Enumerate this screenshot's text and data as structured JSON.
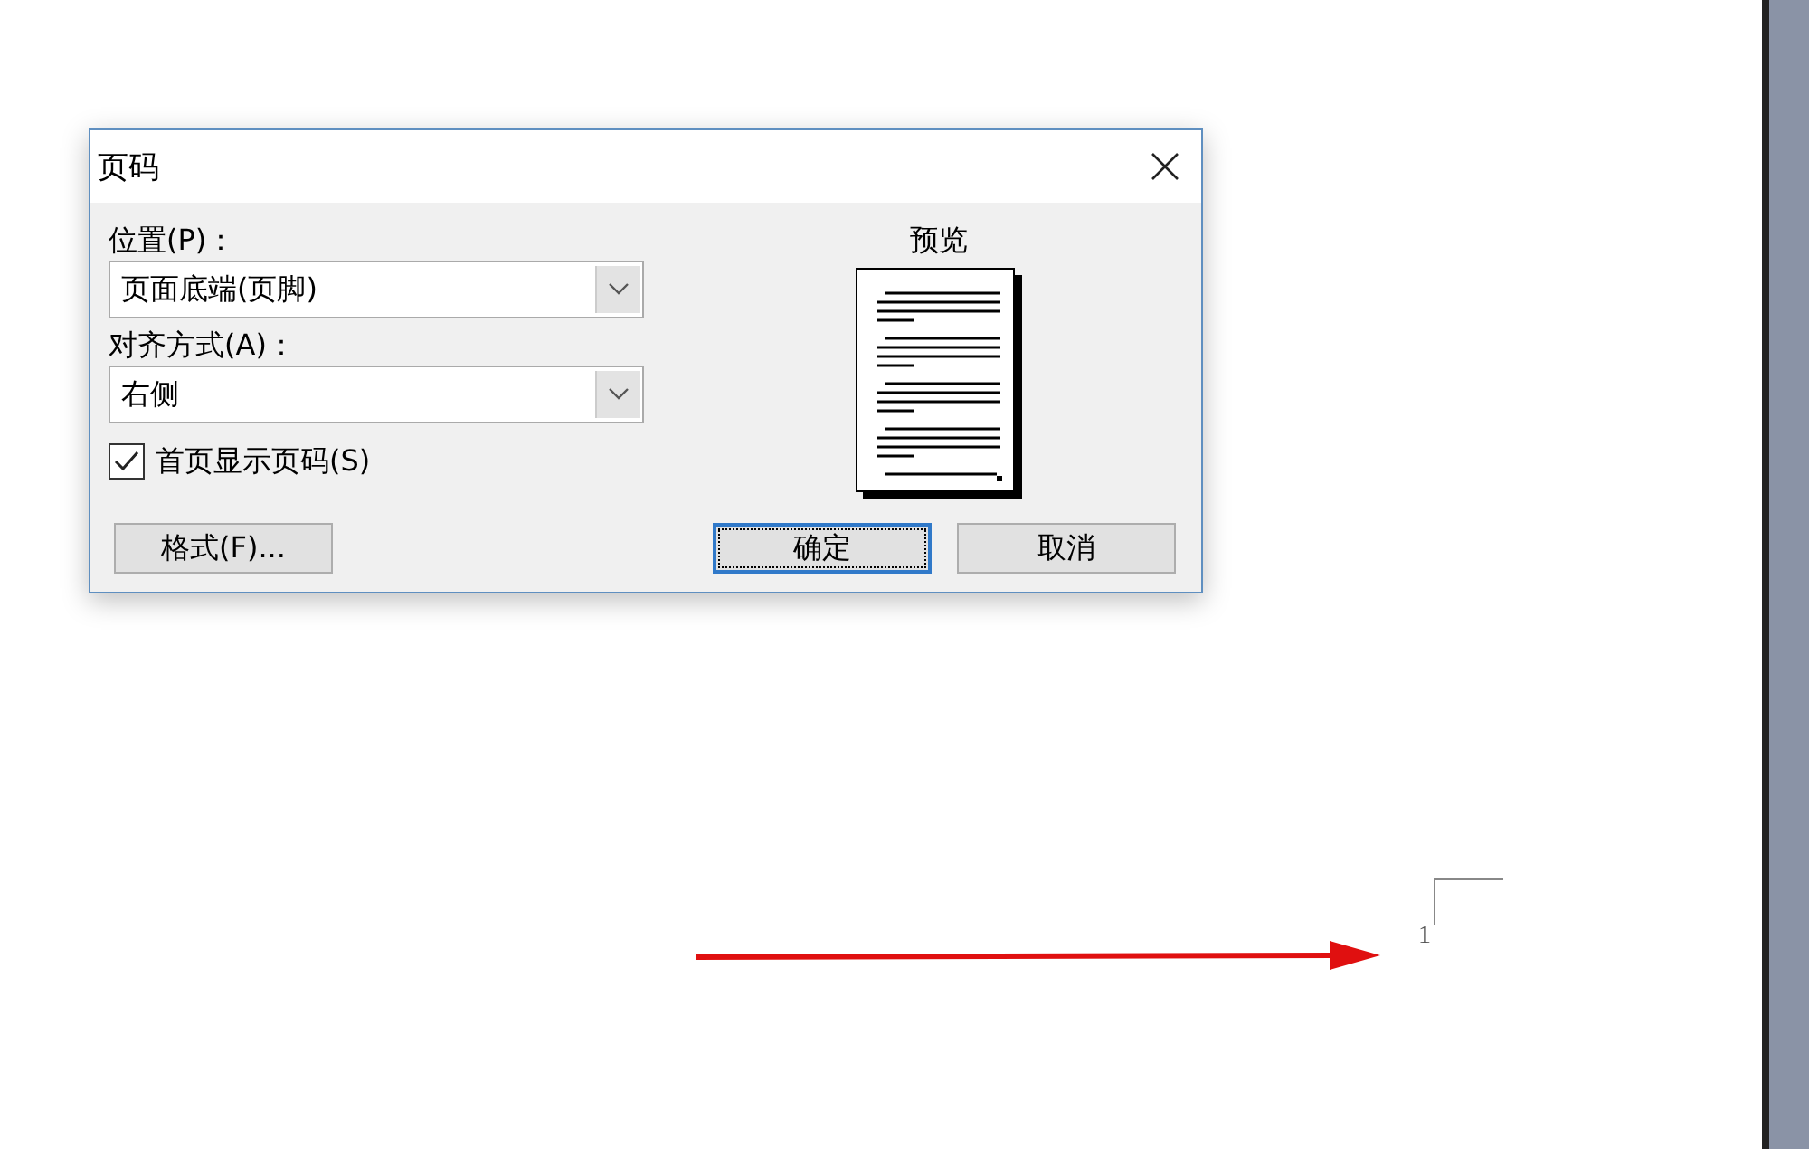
{
  "dialog": {
    "title": "页码",
    "position": {
      "label": "位置(P)：",
      "value": "页面底端(页脚)"
    },
    "alignment": {
      "label": "对齐方式(A)：",
      "value": "右侧"
    },
    "first_page": {
      "label": "首页显示页码(S)",
      "checked": true
    },
    "preview": {
      "label": "预览"
    },
    "format_button": {
      "label": "格式(F)...",
      "default": false
    },
    "ok_button": {
      "label": "确定",
      "default": true
    },
    "cancel_button": {
      "label": "取消",
      "default": false
    }
  },
  "document": {
    "page_number": "1"
  }
}
